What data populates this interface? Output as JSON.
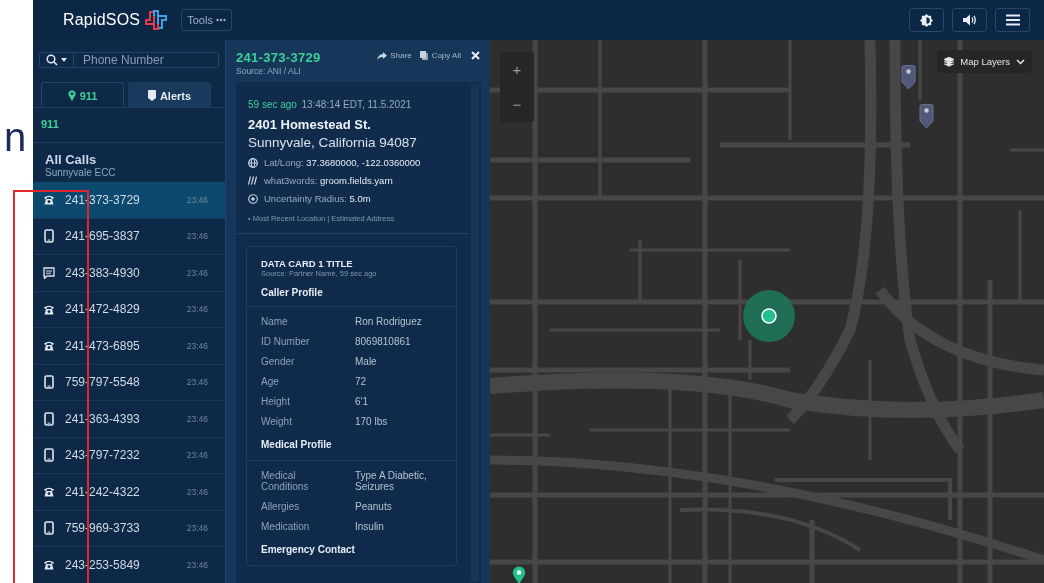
{
  "margin_text": "n",
  "header": {
    "logo": "RapidSOS",
    "tools_button": "Tools"
  },
  "sidebar": {
    "search": {
      "placeholder": "Phone Number"
    },
    "tabs": [
      {
        "kind": "location",
        "label": "911",
        "selected": true
      },
      {
        "kind": "alert",
        "label": "Alerts",
        "selected": false
      }
    ],
    "section_label": "911",
    "group": {
      "title": "All Calls",
      "subtitle": "Sunnyvale ECC"
    },
    "calls": [
      {
        "kind": "landline",
        "number": "241-373-3729",
        "time": "23:46",
        "selected": true
      },
      {
        "kind": "mobile",
        "number": "241-695-3837",
        "time": "23:46",
        "selected": false
      },
      {
        "kind": "text",
        "number": "243-383-4930",
        "time": "23:46",
        "selected": false
      },
      {
        "kind": "landline",
        "number": "241-472-4829",
        "time": "23:46",
        "selected": false
      },
      {
        "kind": "landline",
        "number": "241-473-6895",
        "time": "23:46",
        "selected": false
      },
      {
        "kind": "mobile",
        "number": "759-797-5548",
        "time": "23:46",
        "selected": false
      },
      {
        "kind": "mobile",
        "number": "241-363-4393",
        "time": "23:46",
        "selected": false
      },
      {
        "kind": "mobile",
        "number": "243-797-7232",
        "time": "23:46",
        "selected": false
      },
      {
        "kind": "landline",
        "number": "241-242-4322",
        "time": "23:46",
        "selected": false
      },
      {
        "kind": "mobile",
        "number": "759-969-3733",
        "time": "23:46",
        "selected": false
      },
      {
        "kind": "landline",
        "number": "243-253-5849",
        "time": "23:46",
        "selected": false
      }
    ]
  },
  "detail": {
    "phone": "241-373-3729",
    "source": "Source: ANI / ALI",
    "actions": [
      {
        "kind": "share",
        "label": "Share"
      },
      {
        "kind": "copy",
        "label": "Copy All"
      }
    ],
    "location": {
      "age": "59 sec ago",
      "timestamp": "13:48:14 EDT, 11.5.2021",
      "street": "2401 Homestead St.",
      "city": "Sunnyvale, California 94087",
      "facts": [
        {
          "kind": "latlong",
          "label": "Lat/Long:",
          "value": "37.3680000, -122.0360000"
        },
        {
          "kind": "what3words",
          "label": "what3words:",
          "value": "groom.fields.yarn"
        },
        {
          "kind": "radius",
          "label": "Uncertainty Radius:",
          "value": "5.0m"
        }
      ],
      "note": "• Most Recent Location | Estimated Address"
    },
    "card": {
      "title": "DATA CARD 1 TITLE",
      "source": "Source: Partner Name, 59 sec ago",
      "sections": [
        {
          "title": "Caller Profile",
          "rows": [
            {
              "label": "Name",
              "value": "Ron Rodriguez"
            },
            {
              "label": "ID Number",
              "value": "8069810861"
            },
            {
              "label": "Gender",
              "value": "Male"
            },
            {
              "label": "Age",
              "value": "72"
            },
            {
              "label": "Height",
              "value": "6'1"
            },
            {
              "label": "Weight",
              "value": "170 lbs"
            }
          ]
        },
        {
          "title": "Medical Profile",
          "rows": [
            {
              "label": "Medical Conditions",
              "value": "Type A Diabetic, Seizures"
            },
            {
              "label": "Allergies",
              "value": "Peanuts"
            },
            {
              "label": "Medication",
              "value": "Insulin"
            }
          ]
        },
        {
          "title": "Emergency Contact"
        }
      ]
    }
  },
  "map": {
    "zoom_in": "+",
    "zoom_out": "−",
    "layers_button": "Map Layers"
  }
}
